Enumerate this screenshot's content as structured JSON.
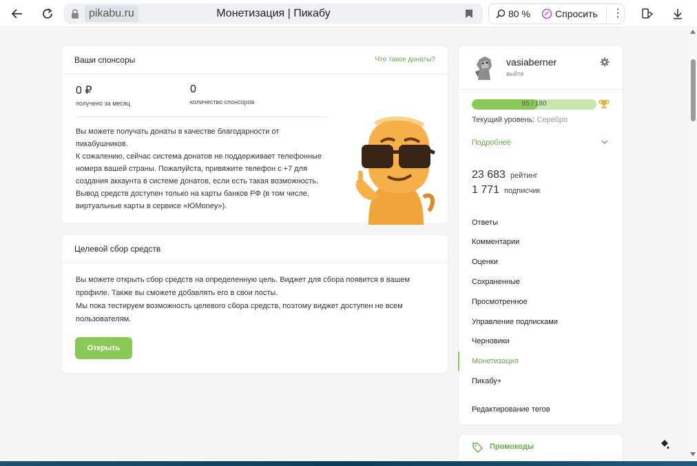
{
  "browser": {
    "domain": "pikabu.ru",
    "title": "Монетизация | Пикабу",
    "zoom": "80 %",
    "ask_label": "Спросить"
  },
  "sponsors": {
    "title": "Ваши спонсоры",
    "what_link": "Что такое донаты?",
    "amount": "0 ₽",
    "amount_label": "получено за месяц",
    "count": "0",
    "count_label": "количество спонсоров",
    "text": [
      "Вы можете получать донаты в качестве благодарности от",
      "пикабушников.",
      "К сожалению, сейчас система донатов не поддерживает телефонные",
      "номера вашей страны. Пожалуйста, привяжите телефон с +7 для",
      "создания аккаунта в системе донатов, если есть такая возможность.",
      "Вывод средств доступен только на карты банков РФ (в том числе,",
      "виртуальные карты в сервисе «ЮMoney»)."
    ]
  },
  "fundraising": {
    "title": "Целевой сбор средств",
    "text": [
      "Вы можете открыть сбор средств на определенную цель. Виджет для сбора появится в вашем",
      "профиле. Также вы сможете добавлять его в свои посты.",
      "Мы пока тестируем возможность целевого сбора средств, поэтому виджет доступен не всем",
      "пользователям."
    ],
    "open_button": "Открыть"
  },
  "profile": {
    "username": "vasiaberner",
    "logout": "выйти",
    "progress_text": "95 / 180",
    "progress_fraction": 0.528,
    "level_label": "Текущий уровень:",
    "level_value": "Серебро",
    "more": "Подробнее",
    "rating_num": "23 683",
    "rating_label": "рейтинг",
    "subs_num": "1 771",
    "subs_label": "подписчик"
  },
  "menu": {
    "items": [
      {
        "label": "Ответы"
      },
      {
        "label": "Комментарии"
      },
      {
        "label": "Оценки"
      },
      {
        "label": "Сохраненные"
      },
      {
        "label": "Просмотренное"
      },
      {
        "label": "Управление подписками"
      },
      {
        "label": "Черновики"
      },
      {
        "label": "Монетизация"
      },
      {
        "label": "Пикабу+"
      },
      {
        "label": "Редактирование тегов"
      }
    ]
  },
  "promo": {
    "label": "Промокоды"
  },
  "colors": {
    "accent_green": "#8ac858",
    "link_green": "#6aa84f"
  }
}
